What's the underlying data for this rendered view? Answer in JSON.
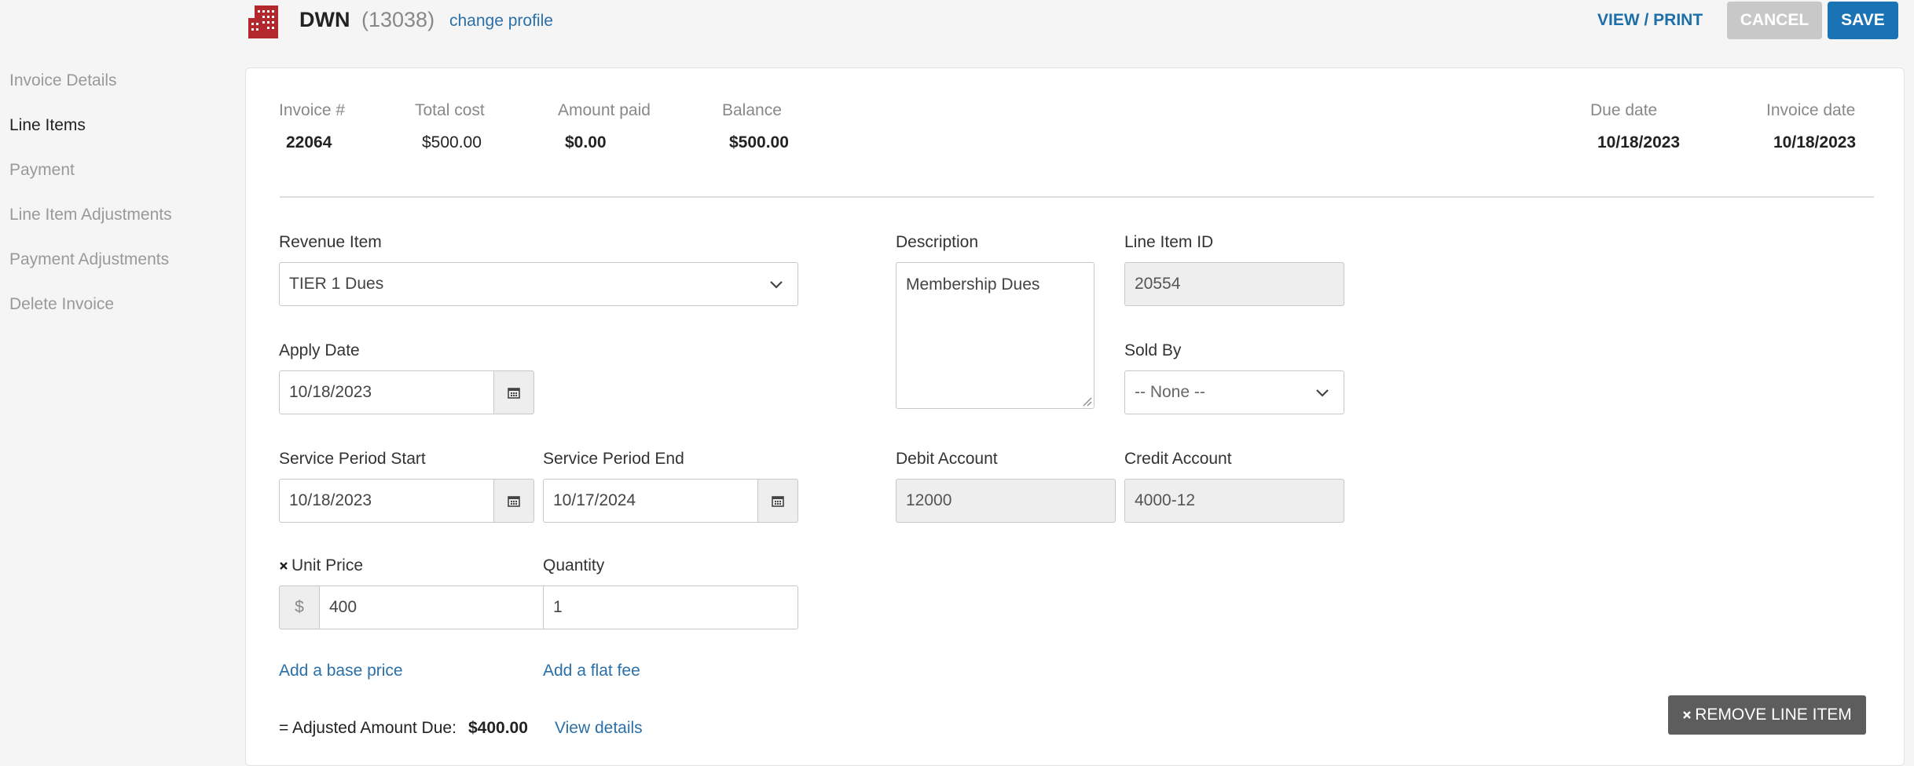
{
  "header": {
    "profile_name": "DWN",
    "profile_id": "(13038)",
    "change_profile": "change profile",
    "view_print": "VIEW / PRINT",
    "cancel": "CANCEL",
    "save": "SAVE"
  },
  "sidebar": {
    "items": [
      {
        "label": "Invoice Details"
      },
      {
        "label": "Line Items",
        "active": true
      },
      {
        "label": "Payment"
      },
      {
        "label": "Line Item Adjustments"
      },
      {
        "label": "Payment Adjustments"
      },
      {
        "label": "Delete Invoice"
      }
    ]
  },
  "summary": {
    "invoice_label": "Invoice #",
    "invoice_value": "22064",
    "total_label": "Total cost",
    "total_value": "$500.00",
    "paid_label": "Amount paid",
    "paid_value": "$0.00",
    "balance_label": "Balance",
    "balance_value": "$500.00",
    "due_label": "Due date",
    "due_value": "10/18/2023",
    "invdate_label": "Invoice date",
    "invdate_value": "10/18/2023"
  },
  "form": {
    "revenue_item_label": "Revenue Item",
    "revenue_item_value": "TIER 1 Dues",
    "apply_date_label": "Apply Date",
    "apply_date_value": "10/18/2023",
    "sps_label": "Service Period Start",
    "sps_value": "10/18/2023",
    "spe_label": "Service Period End",
    "spe_value": "10/17/2024",
    "unit_price_label": "Unit Price",
    "unit_price_currency": "$",
    "unit_price_value": "400",
    "quantity_label": "Quantity",
    "quantity_value": "1",
    "add_base_price": "Add a base price",
    "add_flat_fee": "Add a flat fee",
    "adjusted_label": "= Adjusted Amount Due:",
    "adjusted_value": "$400.00",
    "view_details": "View details",
    "description_label": "Description",
    "description_value": "Membership Dues",
    "line_item_id_label": "Line Item ID",
    "line_item_id_value": "20554",
    "sold_by_label": "Sold By",
    "sold_by_value": "-- None --",
    "debit_label": "Debit Account",
    "debit_value": "12000",
    "credit_label": "Credit Account",
    "credit_value": "4000-12",
    "remove_line_item": "REMOVE LINE ITEM"
  },
  "colors": {
    "accent": "#1a73b5",
    "link": "#2a6fa8",
    "logo": "#b3282d",
    "cancel_disabled": "#c8c8c8",
    "remove_button": "#5d5d5d"
  }
}
